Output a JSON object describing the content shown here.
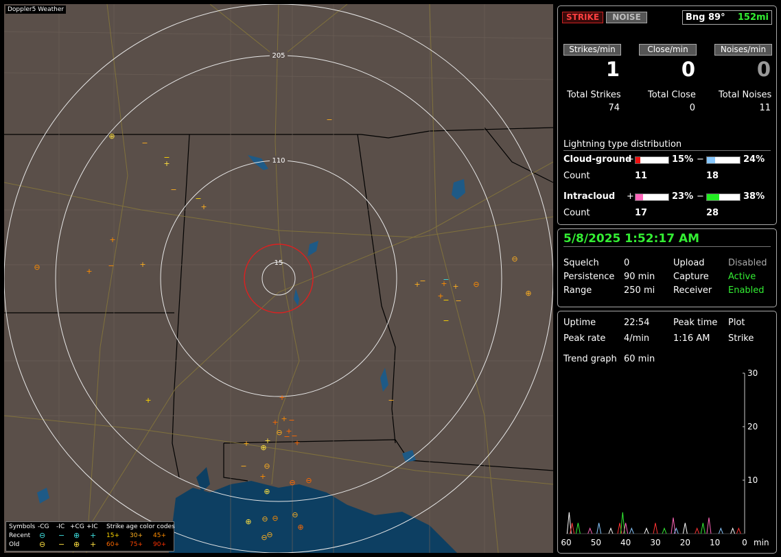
{
  "map": {
    "title": "Doppler5 Weather",
    "ring_labels": [
      "205",
      "110",
      "15"
    ],
    "legend": {
      "symbols_label": "Symbols",
      "neg_cg": "-CG",
      "neg_ic": "-IC",
      "pos_cg": "+CG",
      "pos_ic": "+IC",
      "age_label": "Strike age color codes",
      "recent_label": "Recent",
      "old_label": "Old",
      "ages": [
        "15+",
        "30+",
        "45+",
        "60+",
        "75+",
        "90+"
      ],
      "age_colors": [
        "#ffd700",
        "#ffb020",
        "#ff8c00",
        "#ff6a00",
        "#ff4500",
        "#ff3000"
      ]
    }
  },
  "status": {
    "strike_btn": "STRIKE",
    "noise_btn": "NOISE",
    "bearing": "Bng 89°",
    "distance": "152mi"
  },
  "rates": {
    "strikes_label": "Strikes/min",
    "close_label": "Close/min",
    "noises_label": "Noises/min",
    "strikes": "1",
    "close": "0",
    "noises": "0"
  },
  "totals": {
    "strikes_label": "Total Strikes",
    "close_label": "Total Close",
    "noises_label": "Total Noises",
    "strikes": "74",
    "close": "0",
    "noises": "11"
  },
  "distribution": {
    "title": "Lightning type distribution",
    "cg_label": "Cloud-ground",
    "ic_label": "Intracloud",
    "count_label": "Count",
    "plus": "+",
    "minus": "−",
    "cg_pos_pct": "15%",
    "cg_neg_pct": "24%",
    "ic_pos_pct": "23%",
    "ic_neg_pct": "38%",
    "cg_pos_fill": 0.15,
    "cg_neg_fill": 0.24,
    "ic_pos_fill": 0.23,
    "ic_neg_fill": 0.38,
    "cg_pos_count": "11",
    "cg_neg_count": "18",
    "ic_pos_count": "17",
    "ic_neg_count": "28"
  },
  "clock": {
    "datetime": "5/8/2025 1:52:17 AM",
    "squelch_label": "Squelch",
    "squelch": "0",
    "persistence_label": "Persistence",
    "persistence": "90 min",
    "range_label": "Range",
    "range": "250 mi",
    "upload_label": "Upload",
    "upload": "Disabled",
    "capture_label": "Capture",
    "capture": "Active",
    "receiver_label": "Receiver",
    "receiver": "Enabled"
  },
  "stats": {
    "uptime_label": "Uptime",
    "uptime": "22:54",
    "peak_time_label": "Peak time",
    "peak_time": "1:16 AM",
    "plot_label": "Plot",
    "plot": "Strike",
    "peak_rate_label": "Peak rate",
    "peak_rate": "4/min",
    "trend_label": "Trend graph",
    "trend": "60 min"
  },
  "chart_data": {
    "type": "line",
    "x_ticks": [
      "60",
      "50",
      "40",
      "30",
      "20",
      "10",
      "0"
    ],
    "x_unit": "min",
    "y_ticks": [
      "30",
      "20",
      "10"
    ],
    "ylim": [
      0,
      30
    ],
    "xlim": [
      60,
      0
    ],
    "spikes": [
      {
        "x": 59,
        "h": 4
      },
      {
        "x": 58,
        "h": 2
      },
      {
        "x": 56,
        "h": 2
      },
      {
        "x": 52,
        "h": 1
      },
      {
        "x": 49,
        "h": 2
      },
      {
        "x": 45,
        "h": 1
      },
      {
        "x": 42,
        "h": 2
      },
      {
        "x": 41,
        "h": 4
      },
      {
        "x": 40,
        "h": 2
      },
      {
        "x": 38,
        "h": 1
      },
      {
        "x": 33,
        "h": 1
      },
      {
        "x": 30,
        "h": 2
      },
      {
        "x": 27,
        "h": 1
      },
      {
        "x": 24,
        "h": 3
      },
      {
        "x": 23,
        "h": 1
      },
      {
        "x": 20,
        "h": 2
      },
      {
        "x": 16,
        "h": 1
      },
      {
        "x": 14,
        "h": 2
      },
      {
        "x": 12,
        "h": 3
      },
      {
        "x": 8,
        "h": 1
      },
      {
        "x": 4,
        "h": 1
      },
      {
        "x": 2,
        "h": 1
      }
    ]
  }
}
